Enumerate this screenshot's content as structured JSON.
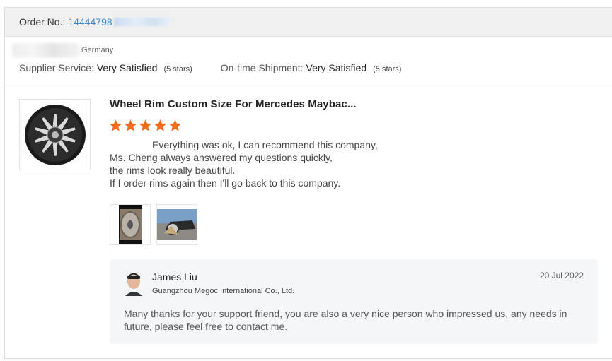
{
  "order": {
    "label": "Order No.:",
    "number": "14444798"
  },
  "buyer": {
    "country": "Germany"
  },
  "ratings": {
    "supplier_service_label": "Supplier Service:",
    "supplier_service_value": "Very Satisfied",
    "supplier_service_stars": "(5 stars)",
    "shipment_label": "On-time Shipment:",
    "shipment_value": "Very Satisfied",
    "shipment_stars": "(5 stars)"
  },
  "product": {
    "title": "Wheel Rim Custom Size For Mercedes Maybac...",
    "star_rating": 5,
    "star_color": "#f26b1d"
  },
  "review": {
    "lines": [
      "Everything was ok, I can recommend this company,",
      "Ms. Cheng always answered my questions quickly,",
      "the rims look really beautiful.",
      "If I order rims again then I'll go back to this company."
    ]
  },
  "reply": {
    "name": "James Liu",
    "company": "Guangzhou Megoc International Co., Ltd.",
    "date": "20 Jul 2022",
    "text": "Many thanks for your support friend, you are also a very nice person who impressed us, any needs in future, please feel free to contact me."
  },
  "colors": {
    "link": "#3b86c6",
    "header_bg": "#f0f0f0",
    "reply_bg": "#f4f6f8"
  }
}
